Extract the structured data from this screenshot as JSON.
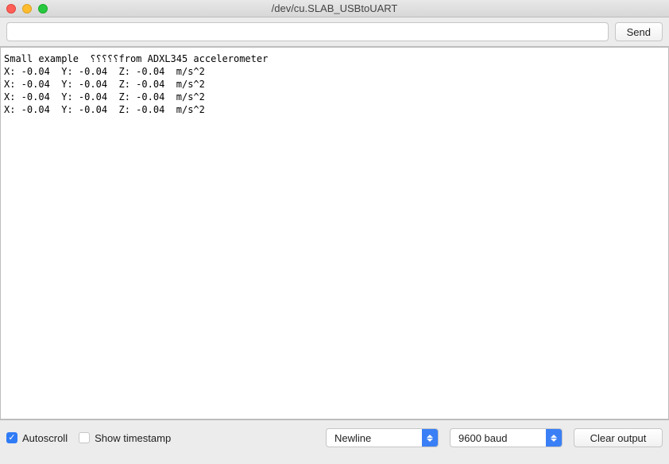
{
  "window": {
    "title": "/dev/cu.SLAB_USBtoUART"
  },
  "toolbar": {
    "send_value": "",
    "send_label": "Send"
  },
  "console": {
    "text": "Small example  ⸮⸮⸮⸮⸮from ADXL345 accelerometer\nX: -0.04  Y: -0.04  Z: -0.04  m/s^2\nX: -0.04  Y: -0.04  Z: -0.04  m/s^2\nX: -0.04  Y: -0.04  Z: -0.04  m/s^2\nX: -0.04  Y: -0.04  Z: -0.04  m/s^2"
  },
  "bottombar": {
    "autoscroll_label": "Autoscroll",
    "autoscroll_checked": true,
    "timestamp_label": "Show timestamp",
    "timestamp_checked": false,
    "lineending": "Newline",
    "baud": "9600 baud",
    "clear_label": "Clear output"
  }
}
